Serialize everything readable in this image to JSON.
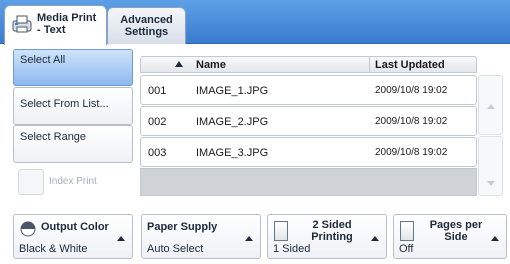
{
  "tabs": [
    {
      "label_line1": "Media Print",
      "label_line2": "- Text",
      "active": true,
      "icon": "media-print-icon"
    },
    {
      "label_line1": "Advanced",
      "label_line2": "Settings",
      "active": false
    }
  ],
  "selection": {
    "buttons": [
      {
        "label": "Select All",
        "selected": true
      },
      {
        "label": "Select From List...",
        "selected": false
      },
      {
        "label": "Select Range",
        "selected": false
      }
    ],
    "index_print": {
      "label": "Index Print",
      "enabled": false
    }
  },
  "file_list": {
    "columns": {
      "name": "Name",
      "last_updated": "Last Updated"
    },
    "sort_icon": "sort-ascending-icon",
    "rows": [
      {
        "num": "001",
        "name": "IMAGE_1.JPG",
        "date": "2009/10/8 19:02"
      },
      {
        "num": "002",
        "name": "IMAGE_2.JPG",
        "date": "2009/10/8 19:02"
      },
      {
        "num": "003",
        "name": "IMAGE_3.JPG",
        "date": "2009/10/8 19:02"
      }
    ]
  },
  "options": [
    {
      "title": "Output Color",
      "value": "Black & White",
      "icon": "output-color-icon"
    },
    {
      "title": "Paper Supply",
      "value": "Auto Select",
      "icon": ""
    },
    {
      "title": "2 Sided Printing",
      "value": "1 Sided",
      "icon": "document-icon"
    },
    {
      "title": "Pages per Side",
      "value": "Off",
      "icon": "document-icon"
    }
  ],
  "colors": {
    "tabbar": "#3c7ccf",
    "selected": "#8bb9f0",
    "list_empty": "#cfd2d6"
  }
}
